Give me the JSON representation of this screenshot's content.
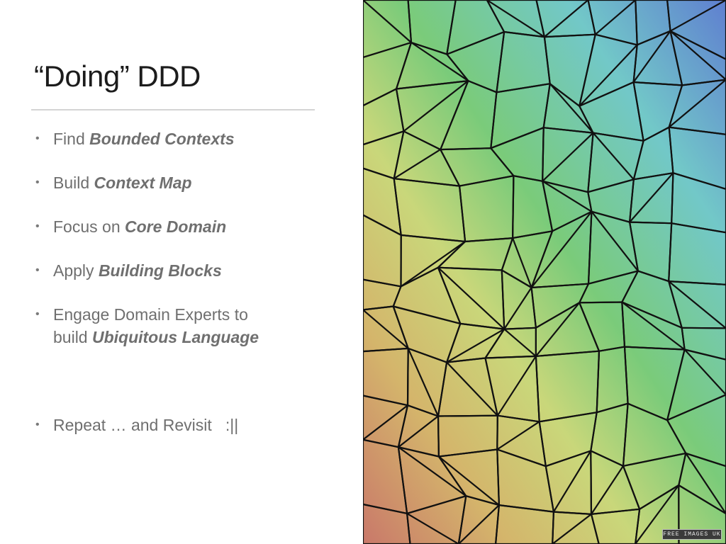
{
  "slide": {
    "title": "“Doing” DDD",
    "bullets": [
      {
        "prefix": "Find ",
        "emphasis": "Bounded Contexts"
      },
      {
        "prefix": "Build ",
        "emphasis": "Context Map"
      },
      {
        "prefix": "Focus on ",
        "emphasis": "Core Domain"
      },
      {
        "prefix": "Apply ",
        "emphasis": "Building Blocks"
      },
      {
        "line1": "Engage Domain Experts to",
        "prefix": "build ",
        "emphasis": "Ubiquitous Language"
      },
      {
        "prefix": "Repeat … and Revisit   :||",
        "emphasis": ""
      }
    ],
    "bullet_glyph": "•"
  },
  "image": {
    "description_icon": "voronoi-mosaic-image",
    "watermark": "FREE IMAGES UK",
    "colors": [
      "#5f7fd0",
      "#72c8c8",
      "#7acb7a",
      "#c9d77a",
      "#d4b56b",
      "#c9786a"
    ]
  }
}
